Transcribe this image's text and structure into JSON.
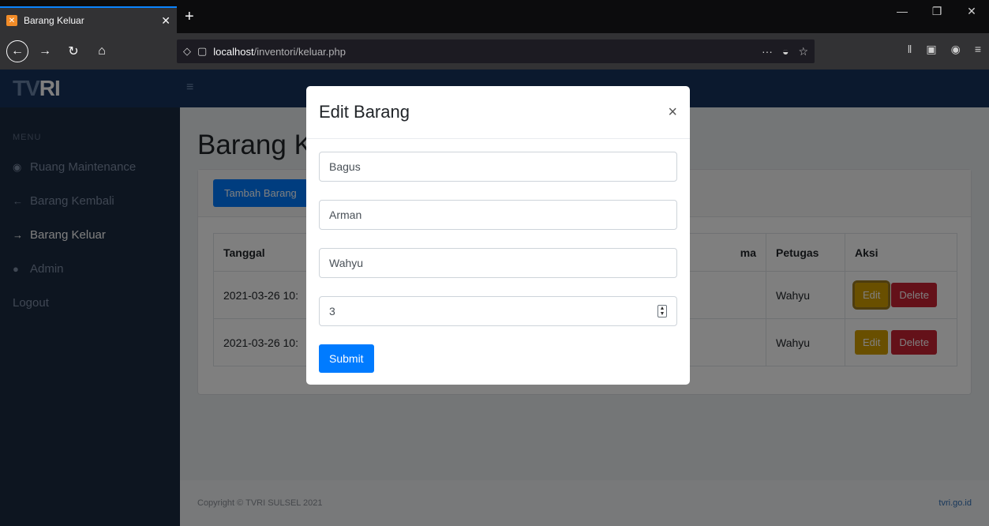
{
  "browser": {
    "tab_title": "Barang Keluar",
    "tab_close": "✕",
    "new_tab": "+",
    "url_host": "localhost",
    "url_path": "/inventori/keluar.php",
    "url_more": "···"
  },
  "sidebar": {
    "logo_prefix": "TV",
    "logo_suffix": "RI",
    "menu_heading": "MENU",
    "items": [
      {
        "icon": "tachometer-icon",
        "glyph": "◉",
        "label": "Ruang Maintenance"
      },
      {
        "icon": "arrow-left-icon",
        "glyph": "←",
        "label": "Barang Kembali"
      },
      {
        "icon": "arrow-right-icon",
        "glyph": "→",
        "label": "Barang Keluar"
      },
      {
        "icon": "user-icon",
        "glyph": "●",
        "label": "Admin"
      },
      {
        "icon": "",
        "glyph": "",
        "label": "Logout"
      }
    ]
  },
  "main": {
    "heading": "Barang Keluar",
    "add_button": "Tambah Barang",
    "table": {
      "headers": [
        "Tanggal",
        "ma",
        "Petugas",
        "Aksi"
      ],
      "rows": [
        {
          "tanggal": "2021-03-26 10:",
          "petugas": "Wahyu"
        },
        {
          "tanggal": "2021-03-26 10:",
          "petugas": "Wahyu"
        }
      ],
      "edit_label": "Edit",
      "delete_label": "Delete"
    }
  },
  "footer": {
    "copyright": "Copyright © TVRI SULSEL 2021",
    "link": "tvri.go.id"
  },
  "modal": {
    "title": "Edit Barang",
    "close": "×",
    "fields": [
      "Bagus",
      "Arman",
      "Wahyu",
      "3"
    ],
    "submit": "Submit"
  },
  "colors": {
    "primary": "#007bff",
    "warning": "#d39e00",
    "danger": "#c82333",
    "sidebar": "#1b2a41",
    "topnav": "#16325c"
  }
}
